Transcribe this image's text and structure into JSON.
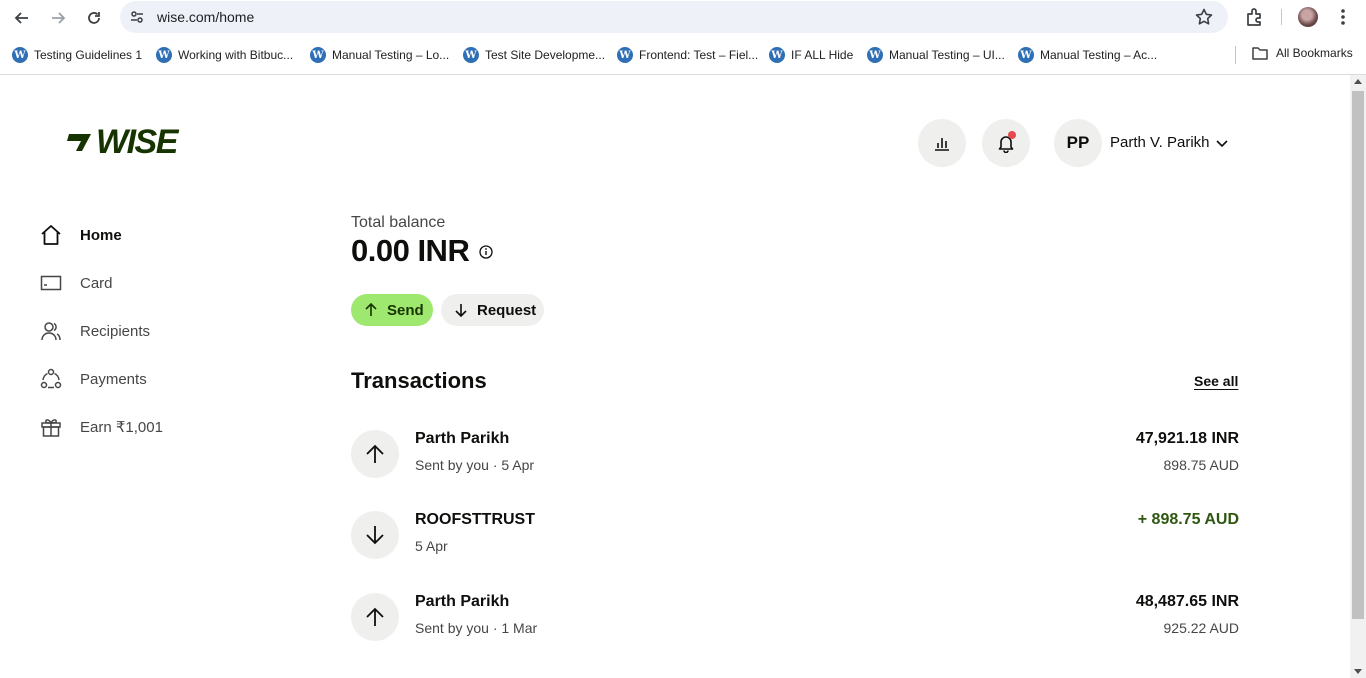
{
  "browser": {
    "url": "wise.com/home",
    "bookmarks": [
      "Testing Guidelines 1",
      "Working with Bitbuc...",
      "Manual Testing – Lo...",
      "Test Site Developme...",
      "Frontend: Test – Fiel...",
      "IF ALL Hide",
      "Manual Testing – UI...",
      "Manual Testing – Ac..."
    ],
    "all_bookmarks": "All Bookmarks",
    "wp_glyph": "W"
  },
  "header": {
    "logo": "WISE",
    "avatar_initials": "PP",
    "user_name": "Parth V. Parikh"
  },
  "nav": {
    "items": [
      {
        "label": "Home",
        "icon": "home-icon"
      },
      {
        "label": "Card",
        "icon": "card-icon"
      },
      {
        "label": "Recipients",
        "icon": "recipients-icon"
      },
      {
        "label": "Payments",
        "icon": "payments-icon"
      },
      {
        "label": "Earn ₹1,001",
        "icon": "gift-icon"
      }
    ]
  },
  "balance": {
    "label": "Total balance",
    "amount": "0.00 INR",
    "send_label": "Send",
    "request_label": "Request"
  },
  "transactions": {
    "title": "Transactions",
    "see_all": "See all",
    "items": [
      {
        "name": "Parth Parikh",
        "sub": "Sent by you · 5 Apr",
        "amount": "47,921.18 INR",
        "amount_secondary": "898.75 AUD",
        "direction": "out"
      },
      {
        "name": "ROOFSTTRUST",
        "sub": "5 Apr",
        "amount": "+ 898.75 AUD",
        "amount_secondary": "",
        "direction": "in"
      },
      {
        "name": "Parth Parikh",
        "sub": "Sent by you · 1 Mar",
        "amount": "48,487.65 INR",
        "amount_secondary": "925.22 AUD",
        "direction": "out"
      }
    ]
  },
  "colors": {
    "brand_green": "#9fe870",
    "forest_green": "#163300",
    "incoming_green": "#2f5711",
    "notification_red": "#e5484d"
  }
}
